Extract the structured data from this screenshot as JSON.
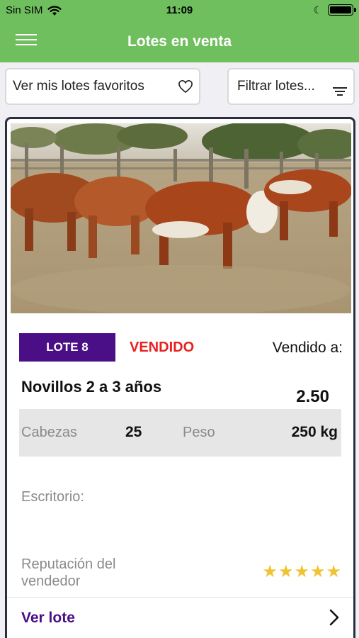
{
  "status_bar": {
    "carrier": "Sin SIM",
    "time": "11:09"
  },
  "nav": {
    "title": "Lotes en venta"
  },
  "actions": {
    "favorites_label": "Ver mis lotes favoritos",
    "filter_label": "Filtrar lotes..."
  },
  "lot": {
    "badge": "LOTE 8",
    "status": "VENDIDO",
    "sold_to_label": "Vendido a:",
    "title": "Novillos 2 a 3 años",
    "price": "2.50",
    "heads_label": "Cabezas",
    "heads_value": "25",
    "weight_label": "Peso",
    "weight_value": "250 kg",
    "office_label": "Escritorio:",
    "reputation_label": "Reputación del vendedor",
    "rating_stars": "★★★★★",
    "rating": 5,
    "view_label": "Ver lote"
  },
  "colors": {
    "brand_green": "#6fbf5f",
    "badge_purple": "#4a0e86",
    "sold_red": "#e8201f",
    "star_gold": "#f2c230"
  },
  "icons": [
    "wifi-icon",
    "moon-icon",
    "battery-icon",
    "menu-icon",
    "heart-icon",
    "filter-icon",
    "chevron-right-icon"
  ]
}
